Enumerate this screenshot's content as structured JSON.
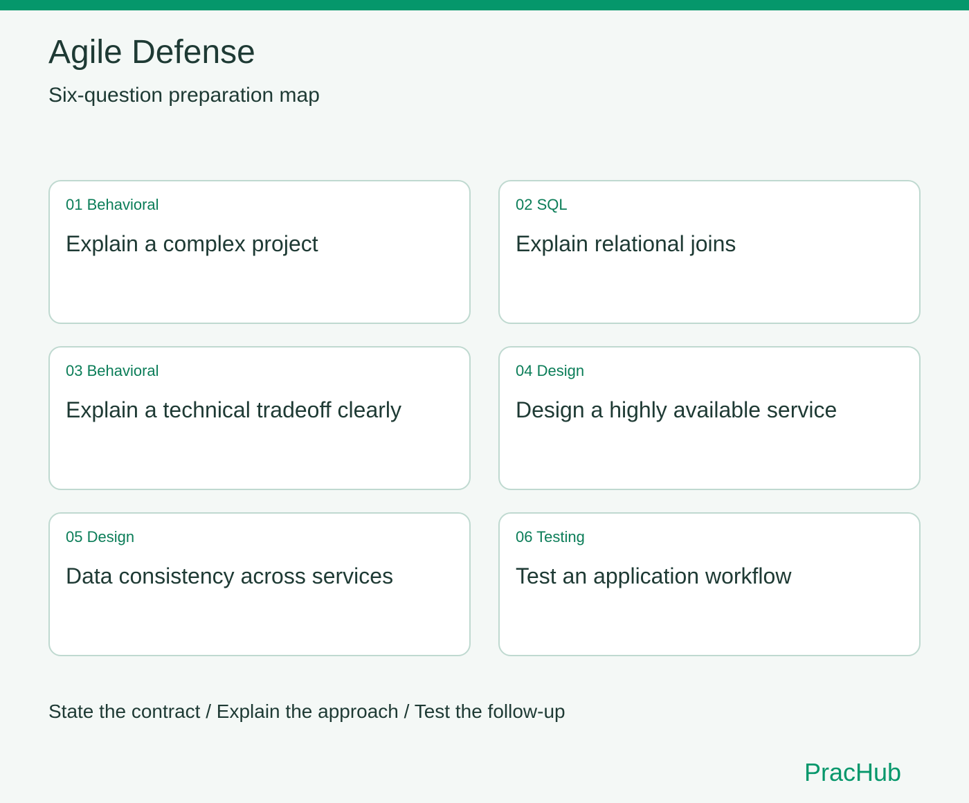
{
  "header": {
    "title": "Agile Defense",
    "subtitle": "Six-question preparation map"
  },
  "cards": [
    {
      "tag": "01 Behavioral",
      "title": "Explain a complex project"
    },
    {
      "tag": "02 SQL",
      "title": "Explain relational joins"
    },
    {
      "tag": "03 Behavioral",
      "title": "Explain a technical tradeoff clearly"
    },
    {
      "tag": "04 Design",
      "title": "Design a highly available service"
    },
    {
      "tag": "05 Design",
      "title": "Data consistency across services"
    },
    {
      "tag": "06 Testing",
      "title": "Test an application workflow"
    }
  ],
  "footer": {
    "note": "State the contract / Explain the approach / Test the follow-up",
    "brand": "PracHub"
  },
  "colors": {
    "accent": "#05976b",
    "tag_text": "#0b7d58",
    "text": "#1e3a34",
    "background": "#f4f8f6",
    "card_border": "#bfd9d0"
  }
}
